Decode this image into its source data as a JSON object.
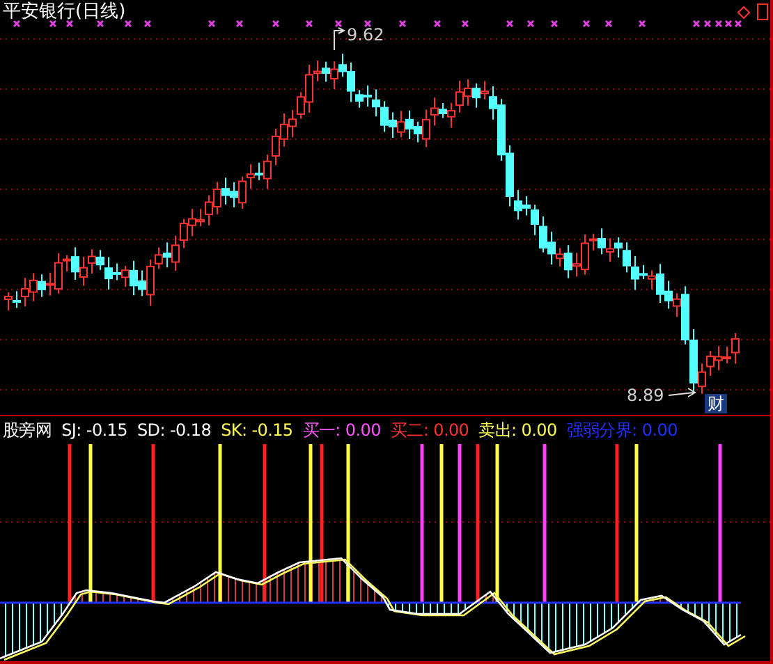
{
  "chart": {
    "title": "平安银行(日线)",
    "high_label": "9.62",
    "low_label": "8.89",
    "event_badge": "财"
  },
  "indicator": {
    "name": "股旁网",
    "values": [
      {
        "label": "SJ: -0.15",
        "color": "#ffffff"
      },
      {
        "label": "SD: -0.18",
        "color": "#ffffff"
      },
      {
        "label": "SK: -0.15",
        "color": "#ffff54"
      },
      {
        "label": "买一: 0.00",
        "color": "#ff54ff"
      },
      {
        "label": "买二: 0.00",
        "color": "#ff3030"
      },
      {
        "label": "卖出: 0.00",
        "color": "#ffff54"
      },
      {
        "label": "强弱分界: 0.00",
        "color": "#2030ff"
      }
    ]
  }
}
